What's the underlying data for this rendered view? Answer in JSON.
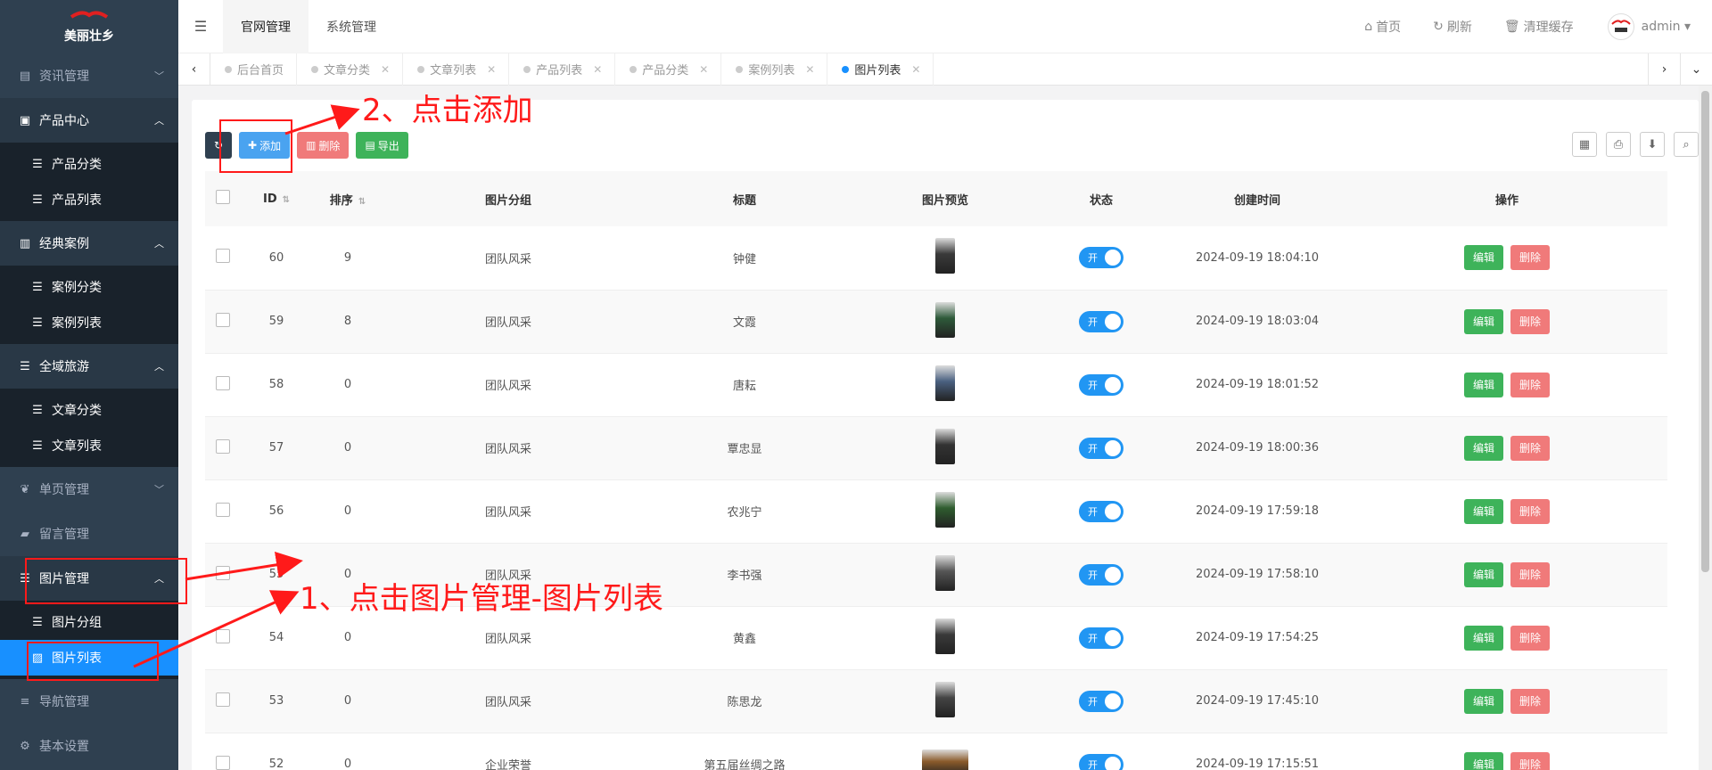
{
  "sidebar": {
    "logo_text": "美丽壮乡",
    "groups": [
      {
        "label": "资讯管理",
        "icon": "document-icon",
        "open": false
      },
      {
        "label": "产品中心",
        "icon": "shopping-bag-icon",
        "open": true,
        "items": [
          {
            "label": "产品分类",
            "icon": "list-icon"
          },
          {
            "label": "产品列表",
            "icon": "list-icon"
          }
        ]
      },
      {
        "label": "经典案例",
        "icon": "briefcase-icon",
        "open": true,
        "items": [
          {
            "label": "案例分类",
            "icon": "list-icon"
          },
          {
            "label": "案例列表",
            "icon": "list-icon"
          }
        ]
      },
      {
        "label": "全域旅游",
        "icon": "list-icon",
        "open": true,
        "items": [
          {
            "label": "文章分类",
            "icon": "list-icon"
          },
          {
            "label": "文章列表",
            "icon": "list-icon"
          }
        ]
      },
      {
        "label": "单页管理",
        "icon": "leaf-icon",
        "open": false
      },
      {
        "label": "留言管理",
        "icon": "book-icon",
        "open": false
      },
      {
        "label": "图片管理",
        "icon": "list-icon",
        "open": true,
        "items": [
          {
            "label": "图片分组",
            "icon": "list-icon"
          },
          {
            "label": "图片列表",
            "icon": "image-icon",
            "active": true
          }
        ]
      },
      {
        "label": "导航管理",
        "icon": "menu-icon",
        "open": false
      },
      {
        "label": "基本设置",
        "icon": "gear-icon",
        "open": false
      }
    ]
  },
  "header": {
    "tabs": [
      "官网管理",
      "系统管理"
    ],
    "links": [
      {
        "label": "首页",
        "icon": "home-icon"
      },
      {
        "label": "刷新",
        "icon": "refresh-icon"
      },
      {
        "label": "清理缓存",
        "icon": "trash-icon"
      }
    ],
    "user": "admin"
  },
  "page_tabs": [
    {
      "label": "后台首页",
      "closable": false
    },
    {
      "label": "文章分类",
      "closable": true
    },
    {
      "label": "文章列表",
      "closable": true
    },
    {
      "label": "产品列表",
      "closable": true
    },
    {
      "label": "产品分类",
      "closable": true
    },
    {
      "label": "案例列表",
      "closable": true
    },
    {
      "label": "图片列表",
      "closable": true,
      "active": true
    }
  ],
  "toolbar": {
    "add": "添加",
    "delete": "删除",
    "export": "导出"
  },
  "table": {
    "columns": [
      "ID",
      "排序",
      "图片分组",
      "标题",
      "图片预览",
      "状态",
      "创建时间",
      "操作"
    ],
    "switch_on": "开",
    "edit": "编辑",
    "remove": "删除",
    "rows": [
      {
        "id": "60",
        "sort": "9",
        "group": "团队风采",
        "title": "钟健",
        "created": "2024-09-19 18:04:10"
      },
      {
        "id": "59",
        "sort": "8",
        "group": "团队风采",
        "title": "文霞",
        "created": "2024-09-19 18:03:04"
      },
      {
        "id": "58",
        "sort": "0",
        "group": "团队风采",
        "title": "唐耘",
        "created": "2024-09-19 18:01:52"
      },
      {
        "id": "57",
        "sort": "0",
        "group": "团队风采",
        "title": "覃忠显",
        "created": "2024-09-19 18:00:36"
      },
      {
        "id": "56",
        "sort": "0",
        "group": "团队风采",
        "title": "农兆宁",
        "created": "2024-09-19 17:59:18"
      },
      {
        "id": "55",
        "sort": "0",
        "group": "团队风采",
        "title": "李书强",
        "created": "2024-09-19 17:58:10"
      },
      {
        "id": "54",
        "sort": "0",
        "group": "团队风采",
        "title": "黄鑫",
        "created": "2024-09-19 17:54:25"
      },
      {
        "id": "53",
        "sort": "0",
        "group": "团队风采",
        "title": "陈思龙",
        "created": "2024-09-19 17:45:10"
      },
      {
        "id": "52",
        "sort": "0",
        "group": "企业荣誉",
        "title": "第五届丝绸之路",
        "created": "2024-09-19 17:15:51"
      }
    ]
  },
  "annotations": {
    "step1": "1、点击图片管理-图片列表",
    "step2": "2、点击添加"
  },
  "colors": {
    "sidebar_bg": "#2f4050",
    "active_blue": "#1890ff",
    "annotation_red": "#ff1a1a"
  }
}
